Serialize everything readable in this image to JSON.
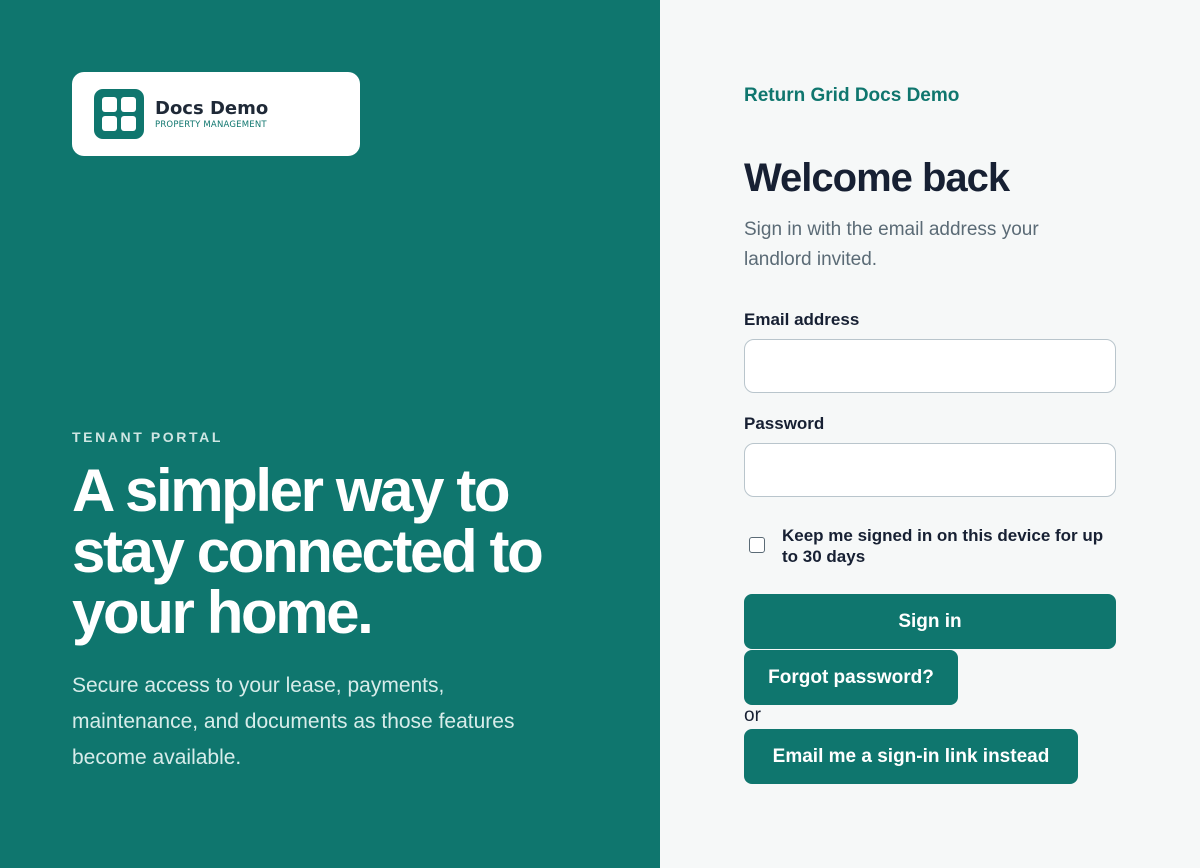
{
  "brand": {
    "name": "Docs Demo",
    "tagline": "PROPERTY MANAGEMENT"
  },
  "hero": {
    "eyebrow": "TENANT PORTAL",
    "headline": "A simpler way to stay connected to your home.",
    "description": "Secure access to your lease, payments, maintenance, and documents as those features become available."
  },
  "form": {
    "return_link": "Return Grid Docs Demo",
    "title": "Welcome back",
    "subtitle": "Sign in with the email address your landlord invited.",
    "email_label": "Email address",
    "email_value": "",
    "password_label": "Password",
    "password_value": "",
    "remember_label": "Keep me signed in on this device for up to 30 days",
    "sign_in_label": "Sign in",
    "forgot_label": "Forgot password?",
    "or_label": "or",
    "magic_link_label": "Email me a sign-in link instead"
  },
  "colors": {
    "brand_teal": "#0f766e",
    "text_dark": "#172033",
    "background": "#f6f8f8"
  }
}
